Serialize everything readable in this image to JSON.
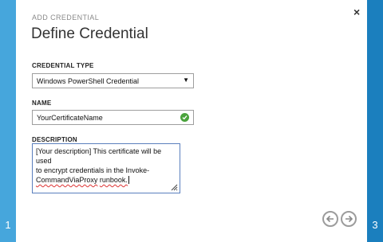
{
  "wizard": {
    "left_step": "1",
    "right_step": "3",
    "close_glyph": "×",
    "overline": "ADD CREDENTIAL",
    "title": "Define Credential"
  },
  "form": {
    "credential_type_label": "CREDENTIAL TYPE",
    "credential_type_value": "Windows PowerShell Credential",
    "name_label": "NAME",
    "name_value": "YourCertificateName",
    "description_label": "DESCRIPTION",
    "description_line1": "[Your description] This certificate will be used",
    "description_line2": "to encrypt credentials in the Invoke-",
    "description_line3_a": "CommandViaProxy",
    "description_line3_b": " ",
    "description_line3_c": "runbook."
  },
  "icons": {
    "select_arrow": "caret-down-icon",
    "valid": "check-circle-icon",
    "resize": "resize-grip-icon",
    "back": "arrow-left-circle-icon",
    "next": "arrow-right-circle-icon"
  },
  "colors": {
    "left_rail": "#46a6dc",
    "right_rail": "#1b7fbe",
    "valid_green": "#4aa33c"
  }
}
